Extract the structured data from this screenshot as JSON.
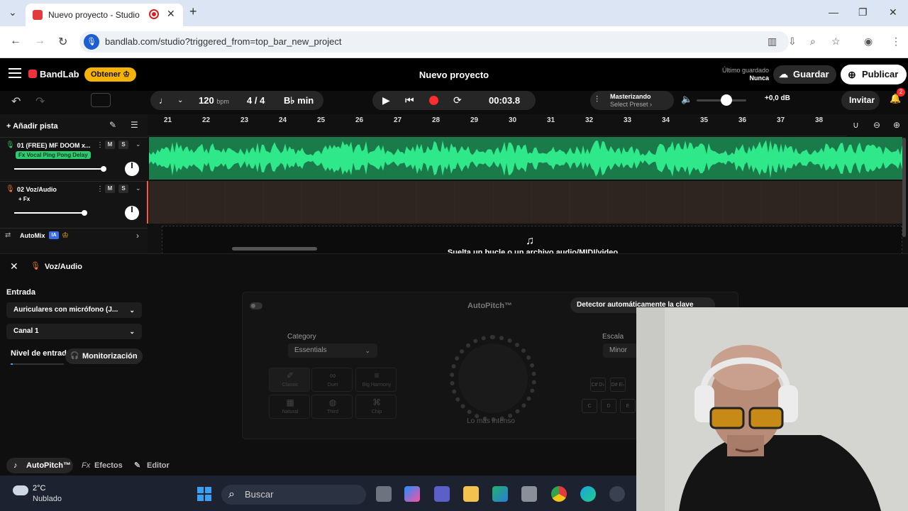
{
  "browser": {
    "tab_title": "Nuevo proyecto - Studio",
    "url": "bandlab.com/studio?triggered_from=top_bar_new_project"
  },
  "header": {
    "logo": "BandLab",
    "obtener": "Obtener",
    "project_title": "Nuevo proyecto",
    "saved_label": "Último guardado",
    "saved_value": "Nunca",
    "guardar": "Guardar",
    "publicar": "Publicar"
  },
  "transport": {
    "bpm": "120",
    "bpm_unit": "bpm",
    "time_sig": "4 / 4",
    "key": "B♭ min",
    "time": "00:03.8",
    "master_label": "Masterizando",
    "master_preset": "Select Preset ›",
    "db": "+0,0 dB",
    "invitar": "Invitar",
    "notif_count": "2",
    "volume_level": 0.6
  },
  "tracklist": {
    "add_track": "Añadir pista",
    "tracks": [
      {
        "name": "01  (FREE) MF DOOM x...",
        "fx": "Fx Vocal Ping Pong Delay",
        "volume": 0.9,
        "accent": "#2ecc71"
      },
      {
        "name": "02  Voz/Audio",
        "fx": "+ Fx",
        "volume": 0.71,
        "accent": "#ff7a2e"
      }
    ],
    "automix": "AutoMix",
    "ia": "IA"
  },
  "ruler": [
    "21",
    "22",
    "23",
    "24",
    "25",
    "26",
    "27",
    "28",
    "29",
    "30",
    "31",
    "32",
    "33",
    "34",
    "35",
    "36",
    "37",
    "38"
  ],
  "droparea": {
    "text": "Suelta un bucle o un archivo audio/MIDI/video"
  },
  "editor": {
    "title": "Voz/Audio",
    "entrada": "Entrada",
    "input_device": "Auriculares con micrófono (J...",
    "channel": "Canal 1",
    "nivel": "Nivel de entrada",
    "monitor": "Monitorización",
    "autopitch_title": "AutoPitch™",
    "detector": "Detector automáticamente la clave",
    "category_label": "Category",
    "category_value": "Essentials",
    "presets": [
      "Classic",
      "Duet",
      "Big Harmony",
      "Natural",
      "Third",
      "Chip"
    ],
    "knob_label": "Lo más intenso",
    "scale_label": "Escala",
    "scale_value": "Minor",
    "keys_top": [
      "C# D♭",
      "D# E♭"
    ],
    "keys_bottom": [
      "C",
      "D",
      "E"
    ],
    "tabs": [
      "AutoPitch™",
      "Efectos",
      "Editor"
    ]
  },
  "taskbar": {
    "temp": "2°C",
    "condition": "Nublado",
    "search": "Buscar"
  },
  "colors": {
    "accent_green": "#2ecc71",
    "record_red": "#ff2d2d",
    "brand_yellow": "#f5b30a"
  }
}
